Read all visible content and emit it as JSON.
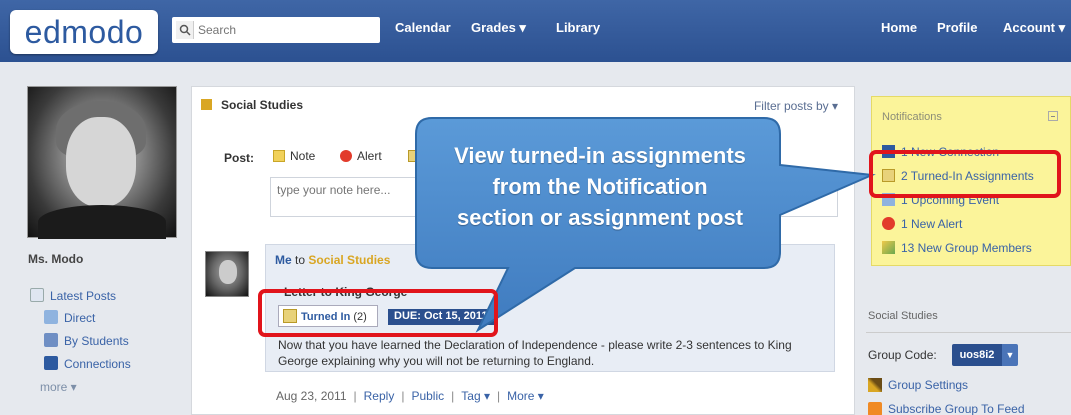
{
  "header": {
    "logo": "edmodo",
    "search_placeholder": "Search",
    "nav": [
      "Calendar",
      "Grades ▾",
      "Library"
    ],
    "right_nav": [
      "Home",
      "Profile",
      "Account ▾"
    ]
  },
  "profile": {
    "name": "Ms. Modo",
    "links": [
      "Latest Posts",
      "Direct",
      "By Students",
      "Connections",
      "more ▾"
    ]
  },
  "feed": {
    "group_title": "Social Studies",
    "filter_label": "Filter posts by ▾",
    "post_label": "Post:",
    "post_types": [
      "Note",
      "Alert"
    ],
    "note_placeholder": "type your note here...",
    "post": {
      "from": "Me",
      "to_word": "to",
      "to_group": "Social Studies",
      "title": "Letter to King George",
      "turned_in_label": "Turned In",
      "turned_in_count": "(2)",
      "due": "DUE: Oct 15, 2011",
      "body": "Now that you have learned the Declaration of Independence - please write 2-3 sentences to King George explaining why you will not be returning to England.",
      "date": "Aug 23, 2011",
      "actions": [
        "Reply",
        "Public",
        "Tag ▾",
        "More ▾"
      ]
    }
  },
  "notifications": {
    "title": "Notifications",
    "items": [
      "1 New Connection",
      "2 Turned-In Assignments",
      "1 Upcoming Event",
      "1 New Alert",
      "13 New Group Members"
    ]
  },
  "group_panel": {
    "title": "Social Studies",
    "group_code_label": "Group Code:",
    "group_code": "uos8i2",
    "links": [
      "Group Settings",
      "Subscribe Group To Feed"
    ]
  },
  "callout": {
    "lines": [
      "View turned-in assignments",
      "from the Notification",
      "section or assignment post"
    ],
    "color": "#4a87c9"
  },
  "colors": {
    "topbar": "#3a5f9e",
    "highlight": "#e1141b",
    "link": "#3a63a7",
    "notif_bg": "#fbf49a"
  }
}
